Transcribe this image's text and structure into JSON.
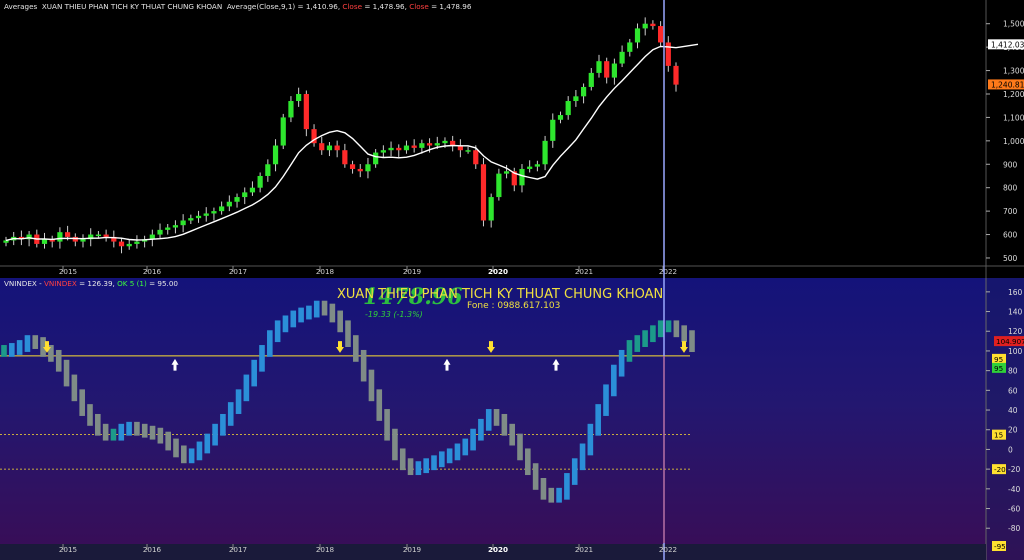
{
  "price_panel": {
    "title_prefix": "Averages",
    "title_name": "XUAN THIEU PHAN TICH KY THUAT CHUNG KHOAN",
    "avg_label": "Average(Close,9,1) = 1,410.96,",
    "close_label_1": "Close",
    "close_value_1": "= 1,478.96,",
    "close_label_2": "Close",
    "close_value_2": "= 1,478.96",
    "y_ticks": [
      "1,500",
      "1,400",
      "1,300",
      "1,200",
      "1,100",
      "1,000",
      "900",
      "800",
      "700",
      "600",
      "500"
    ],
    "y_tick_values": [
      1500,
      1400,
      1300,
      1200,
      1100,
      1000,
      900,
      800,
      700,
      600,
      500
    ],
    "ma_badge": "1,412.03",
    "ma_badge_value": 1412.03,
    "close_badge": "1,240.81",
    "close_badge_value": 1240.81,
    "x_labels": [
      "2015",
      "2016",
      "2017",
      "2018",
      "2019",
      "2020",
      "2021",
      "2022"
    ],
    "x_bold": "2020"
  },
  "osc_panel": {
    "series_name": "VNINDEX -",
    "series_red": "VNINDEX",
    "series_value": "= 126.39,",
    "ok_label": "OK 5 (1)",
    "ok_value": "= 95.00",
    "center_title": "XUAN THIEU PHAN TICH KY THUAT CHUNG KHOAN",
    "center_price": "1478.96",
    "phone": "Fone : 0988.617.103",
    "change": "-19.33  (-1.3%)",
    "y_ticks": [
      "160",
      "140",
      "120",
      "100",
      "80",
      "60",
      "40",
      "20",
      "0",
      "-20",
      "-40",
      "-60",
      "-80"
    ],
    "y_tick_values": [
      160,
      140,
      120,
      100,
      80,
      60,
      40,
      20,
      0,
      -20,
      -40,
      -60,
      -80
    ],
    "badges": [
      {
        "label": "104.907",
        "value": 104.9,
        "color": "#e02020"
      },
      {
        "label": "95",
        "value": 95,
        "color": "#ffe030"
      },
      {
        "label": "95",
        "value": 95,
        "color": "#2fd13a"
      },
      {
        "label": "15",
        "value": 15,
        "color": "#ffe030"
      },
      {
        "label": "-20",
        "value": -20,
        "color": "#ffe030"
      },
      {
        "label": "-95",
        "value": -95,
        "color": "#ffe030"
      }
    ],
    "x_labels": [
      "2015",
      "2016",
      "2017",
      "2018",
      "2019",
      "2020",
      "2021",
      "2022"
    ],
    "x_bold": "2020"
  },
  "colors": {
    "up_candle": "#2ee62e",
    "down_candle": "#ff2a2a",
    "ma_line": "#ffffff",
    "cursor": "#9aa8ff",
    "hist_up": "#2b8fd8",
    "hist_down": "#7f8c87",
    "hist_neutral": "#1c9a8a",
    "level_line": "#ffe030"
  },
  "chart_data": [
    {
      "type": "candlestick",
      "title": "XUAN THIEU PHAN TICH KY THUAT CHUNG KHOAN",
      "series": [
        {
          "name": "Average(Close,9,1)",
          "values": []
        },
        {
          "name": "Close",
          "values": []
        }
      ],
      "x": [
        "2015",
        "2016",
        "2017",
        "2018",
        "2019",
        "2020",
        "2021",
        "2022"
      ],
      "approx_monthly_close": [
        575,
        590,
        580,
        600,
        560,
        580,
        570,
        610,
        590,
        570,
        580,
        600,
        600,
        590,
        570,
        550,
        560,
        570,
        580,
        600,
        620,
        630,
        640,
        660,
        670,
        680,
        690,
        700,
        720,
        740,
        760,
        780,
        800,
        850,
        900,
        980,
        1100,
        1170,
        1200,
        1050,
        990,
        960,
        980,
        960,
        900,
        880,
        870,
        900,
        950,
        960,
        970,
        960,
        980,
        970,
        990,
        980,
        990,
        1000,
        980,
        960,
        960,
        900,
        660,
        760,
        860,
        870,
        810,
        880,
        890,
        900,
        1000,
        1090,
        1110,
        1170,
        1190,
        1230,
        1290,
        1340,
        1270,
        1330,
        1380,
        1420,
        1480,
        1500,
        1490,
        1420,
        1320,
        1240
      ],
      "ylim": [
        470,
        1550
      ]
    },
    {
      "type": "bar",
      "title": "XUAN THIEU PHAN TICH KY THUAT CHUNG KHOAN",
      "series": [
        {
          "name": "VNINDEX",
          "values": []
        },
        {
          "name": "OK 5 (1)",
          "values": []
        }
      ],
      "reference_lines": [
        95,
        15,
        -20
      ],
      "approx_values": [
        100,
        102,
        105,
        110,
        108,
        100,
        95,
        85,
        70,
        55,
        40,
        30,
        20,
        15,
        15,
        20,
        22,
        20,
        18,
        16,
        12,
        5,
        -2,
        -8,
        -5,
        2,
        10,
        20,
        30,
        42,
        55,
        70,
        85,
        100,
        115,
        125,
        130,
        135,
        138,
        140,
        145,
        142,
        135,
        125,
        110,
        95,
        75,
        55,
        35,
        15,
        -5,
        -15,
        -20,
        -18,
        -15,
        -12,
        -8,
        -5,
        0,
        5,
        15,
        25,
        35,
        30,
        20,
        10,
        -5,
        -20,
        -35,
        -45,
        -48,
        -45,
        -30,
        -15,
        0,
        20,
        40,
        60,
        80,
        95,
        105,
        110,
        115,
        120,
        125,
        125,
        120,
        115,
        104.9
      ],
      "ylim": [
        -95,
        170
      ]
    }
  ]
}
